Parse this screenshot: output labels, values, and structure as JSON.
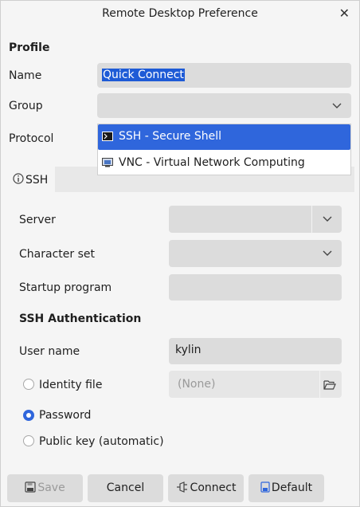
{
  "window": {
    "title": "Remote Desktop Preference",
    "close_glyph": "✕"
  },
  "profile": {
    "heading": "Profile",
    "name_label": "Name",
    "name_value": "Quick Connect",
    "group_label": "Group",
    "group_value": "",
    "protocol_label": "Protocol"
  },
  "protocol_dropdown": {
    "options": [
      {
        "label": "SSH - Secure Shell",
        "icon": "terminal-icon",
        "selected": true
      },
      {
        "label": "VNC - Virtual Network Computing",
        "icon": "monitor-icon",
        "selected": false
      }
    ]
  },
  "tabs": [
    {
      "label": "SSH",
      "icon": "info-icon"
    }
  ],
  "ssh": {
    "server_label": "Server",
    "server_value": "",
    "charset_label": "Character set",
    "charset_value": "",
    "startup_label": "Startup program",
    "startup_value": "",
    "auth_heading": "SSH Authentication",
    "username_label": "User name",
    "username_value": "kylin",
    "identity_label": "Identity file",
    "identity_placeholder": "(None)",
    "password_label": "Password",
    "pubkey_label": "Public key (automatic)",
    "auth_selected": "password"
  },
  "buttons": {
    "save": "Save",
    "cancel": "Cancel",
    "connect": "Connect",
    "default": "Default"
  },
  "colors": {
    "accent": "#2f66dc",
    "field_bg": "#dcdcdc",
    "window_bg": "#f5f5f5"
  }
}
